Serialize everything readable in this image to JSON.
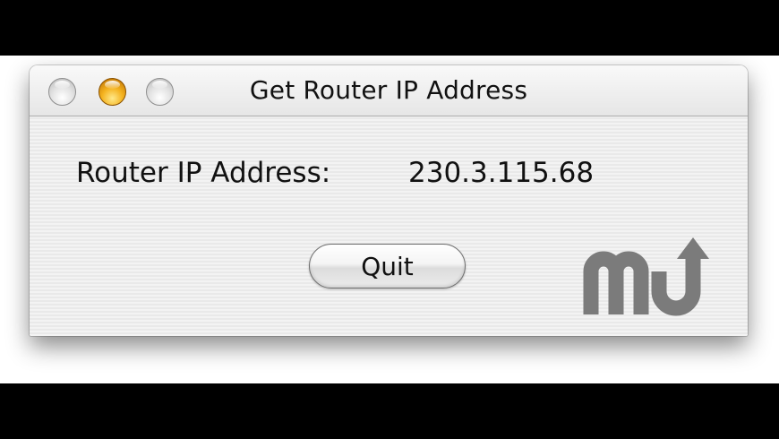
{
  "window": {
    "title": "Get Router IP Address",
    "controls": [
      "close",
      "minimize",
      "zoom"
    ]
  },
  "main": {
    "label": "Router IP Address:",
    "value": "230.3.115.68"
  },
  "buttons": {
    "quit_label": "Quit"
  },
  "watermark": {
    "text": "mu",
    "color": "#7b7b7b"
  },
  "colors": {
    "minimize_accent": "#f4b21e",
    "letterbox": "#000000"
  }
}
